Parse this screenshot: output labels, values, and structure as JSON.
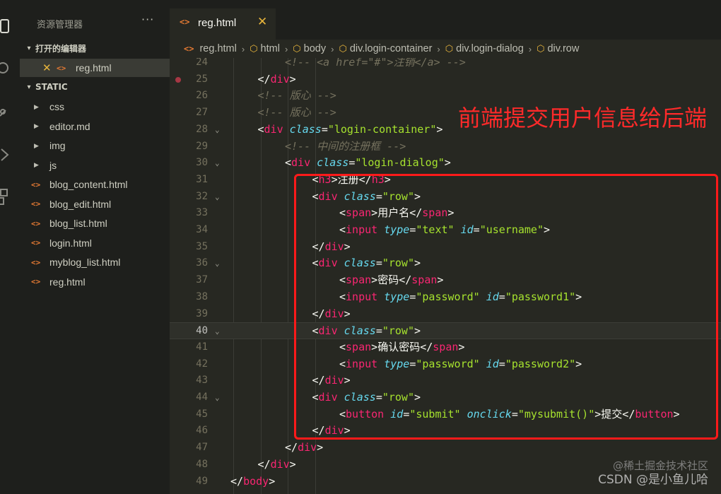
{
  "explorer": {
    "title": "资源管理器",
    "more_label": "···",
    "open_editors_label": "打开的编辑器",
    "open_editor_file": "reg.html",
    "folder_label": "STATIC",
    "folders": [
      "css",
      "editor.md",
      "img",
      "js"
    ],
    "files": [
      "blog_content.html",
      "blog_edit.html",
      "blog_list.html",
      "login.html",
      "myblog_list.html",
      "reg.html"
    ]
  },
  "tab": {
    "label": "reg.html",
    "close": "✕"
  },
  "breadcrumb": {
    "file": "reg.html",
    "items": [
      "html",
      "body",
      "div.login-container",
      "div.login-dialog",
      "div.row"
    ]
  },
  "editor": {
    "current_line": 40,
    "lines": [
      {
        "n": 24,
        "fold": false,
        "indent": 2,
        "tokens": [
          [
            "cm",
            "<!-- <a href=\"#\">注销</a> -->"
          ]
        ]
      },
      {
        "n": 25,
        "fold": false,
        "indent": 1,
        "tokens": [
          [
            "pu",
            "</"
          ],
          [
            "tg",
            "div"
          ],
          [
            "pu",
            ">"
          ]
        ]
      },
      {
        "n": 26,
        "fold": false,
        "indent": 1,
        "tokens": [
          [
            "cm",
            "<!-- 版心 -->"
          ]
        ]
      },
      {
        "n": 27,
        "fold": false,
        "indent": 1,
        "tokens": [
          [
            "cm",
            "<!-- 版心 -->"
          ]
        ]
      },
      {
        "n": 28,
        "fold": true,
        "indent": 1,
        "tokens": [
          [
            "pu",
            "<"
          ],
          [
            "tg",
            "div"
          ],
          [
            "tx",
            " "
          ],
          [
            "at",
            "class"
          ],
          [
            "pu",
            "="
          ],
          [
            "st",
            "\"login-container\""
          ],
          [
            "pu",
            ">"
          ]
        ]
      },
      {
        "n": 29,
        "fold": false,
        "indent": 2,
        "tokens": [
          [
            "cm",
            "<!-- 中间的注册框 -->"
          ]
        ]
      },
      {
        "n": 30,
        "fold": true,
        "indent": 2,
        "tokens": [
          [
            "pu",
            "<"
          ],
          [
            "tg",
            "div"
          ],
          [
            "tx",
            " "
          ],
          [
            "at",
            "class"
          ],
          [
            "pu",
            "="
          ],
          [
            "st",
            "\"login-dialog\""
          ],
          [
            "pu",
            ">"
          ]
        ]
      },
      {
        "n": 31,
        "fold": false,
        "indent": 3,
        "tokens": [
          [
            "pu",
            "<"
          ],
          [
            "tg",
            "h3"
          ],
          [
            "pu",
            ">"
          ],
          [
            "tx",
            "注册"
          ],
          [
            "pu",
            "</"
          ],
          [
            "tg",
            "h3"
          ],
          [
            "pu",
            ">"
          ]
        ]
      },
      {
        "n": 32,
        "fold": true,
        "indent": 3,
        "tokens": [
          [
            "pu",
            "<"
          ],
          [
            "tg",
            "div"
          ],
          [
            "tx",
            " "
          ],
          [
            "at",
            "class"
          ],
          [
            "pu",
            "="
          ],
          [
            "st",
            "\"row\""
          ],
          [
            "pu",
            ">"
          ]
        ]
      },
      {
        "n": 33,
        "fold": false,
        "indent": 4,
        "tokens": [
          [
            "pu",
            "<"
          ],
          [
            "tg",
            "span"
          ],
          [
            "pu",
            ">"
          ],
          [
            "tx",
            "用户名"
          ],
          [
            "pu",
            "</"
          ],
          [
            "tg",
            "span"
          ],
          [
            "pu",
            ">"
          ]
        ]
      },
      {
        "n": 34,
        "fold": false,
        "indent": 4,
        "tokens": [
          [
            "pu",
            "<"
          ],
          [
            "tg",
            "input"
          ],
          [
            "tx",
            " "
          ],
          [
            "at",
            "type"
          ],
          [
            "pu",
            "="
          ],
          [
            "st",
            "\"text\""
          ],
          [
            "tx",
            " "
          ],
          [
            "at",
            "id"
          ],
          [
            "pu",
            "="
          ],
          [
            "st",
            "\"username\""
          ],
          [
            "pu",
            ">"
          ]
        ]
      },
      {
        "n": 35,
        "fold": false,
        "indent": 3,
        "tokens": [
          [
            "pu",
            "</"
          ],
          [
            "tg",
            "div"
          ],
          [
            "pu",
            ">"
          ]
        ]
      },
      {
        "n": 36,
        "fold": true,
        "indent": 3,
        "tokens": [
          [
            "pu",
            "<"
          ],
          [
            "tg",
            "div"
          ],
          [
            "tx",
            " "
          ],
          [
            "at",
            "class"
          ],
          [
            "pu",
            "="
          ],
          [
            "st",
            "\"row\""
          ],
          [
            "pu",
            ">"
          ]
        ]
      },
      {
        "n": 37,
        "fold": false,
        "indent": 4,
        "tokens": [
          [
            "pu",
            "<"
          ],
          [
            "tg",
            "span"
          ],
          [
            "pu",
            ">"
          ],
          [
            "tx",
            "密码"
          ],
          [
            "pu",
            "</"
          ],
          [
            "tg",
            "span"
          ],
          [
            "pu",
            ">"
          ]
        ]
      },
      {
        "n": 38,
        "fold": false,
        "indent": 4,
        "tokens": [
          [
            "pu",
            "<"
          ],
          [
            "tg",
            "input"
          ],
          [
            "tx",
            " "
          ],
          [
            "at",
            "type"
          ],
          [
            "pu",
            "="
          ],
          [
            "st",
            "\"password\""
          ],
          [
            "tx",
            " "
          ],
          [
            "at",
            "id"
          ],
          [
            "pu",
            "="
          ],
          [
            "st",
            "\"password1\""
          ],
          [
            "pu",
            ">"
          ]
        ]
      },
      {
        "n": 39,
        "fold": false,
        "indent": 3,
        "tokens": [
          [
            "pu",
            "</"
          ],
          [
            "tg",
            "div"
          ],
          [
            "pu",
            ">"
          ]
        ]
      },
      {
        "n": 40,
        "fold": true,
        "indent": 3,
        "tokens": [
          [
            "pu",
            "<"
          ],
          [
            "tg",
            "div"
          ],
          [
            "tx",
            " "
          ],
          [
            "at",
            "class"
          ],
          [
            "pu",
            "="
          ],
          [
            "st",
            "\"row\""
          ],
          [
            "pu",
            ">"
          ]
        ]
      },
      {
        "n": 41,
        "fold": false,
        "indent": 4,
        "tokens": [
          [
            "pu",
            "<"
          ],
          [
            "tg",
            "span"
          ],
          [
            "pu",
            ">"
          ],
          [
            "tx",
            "确认密码"
          ],
          [
            "pu",
            "</"
          ],
          [
            "tg",
            "span"
          ],
          [
            "pu",
            ">"
          ]
        ]
      },
      {
        "n": 42,
        "fold": false,
        "indent": 4,
        "tokens": [
          [
            "pu",
            "<"
          ],
          [
            "tg",
            "input"
          ],
          [
            "tx",
            " "
          ],
          [
            "at",
            "type"
          ],
          [
            "pu",
            "="
          ],
          [
            "st",
            "\"password\""
          ],
          [
            "tx",
            " "
          ],
          [
            "at",
            "id"
          ],
          [
            "pu",
            "="
          ],
          [
            "st",
            "\"password2\""
          ],
          [
            "pu",
            ">"
          ]
        ]
      },
      {
        "n": 43,
        "fold": false,
        "indent": 3,
        "tokens": [
          [
            "pu",
            "</"
          ],
          [
            "tg",
            "div"
          ],
          [
            "pu",
            ">"
          ]
        ]
      },
      {
        "n": 44,
        "fold": true,
        "indent": 3,
        "tokens": [
          [
            "pu",
            "<"
          ],
          [
            "tg",
            "div"
          ],
          [
            "tx",
            " "
          ],
          [
            "at",
            "class"
          ],
          [
            "pu",
            "="
          ],
          [
            "st",
            "\"row\""
          ],
          [
            "pu",
            ">"
          ]
        ]
      },
      {
        "n": 45,
        "fold": false,
        "indent": 4,
        "tokens": [
          [
            "pu",
            "<"
          ],
          [
            "tg",
            "button"
          ],
          [
            "tx",
            " "
          ],
          [
            "at",
            "id"
          ],
          [
            "pu",
            "="
          ],
          [
            "st",
            "\"submit\""
          ],
          [
            "tx",
            " "
          ],
          [
            "at",
            "onclick"
          ],
          [
            "pu",
            "="
          ],
          [
            "st",
            "\"mysubmit()\""
          ],
          [
            "pu",
            ">"
          ],
          [
            "tx",
            "提交"
          ],
          [
            "pu",
            "</"
          ],
          [
            "tg",
            "button"
          ],
          [
            "pu",
            ">"
          ]
        ]
      },
      {
        "n": 46,
        "fold": false,
        "indent": 3,
        "tokens": [
          [
            "pu",
            "</"
          ],
          [
            "tg",
            "div"
          ],
          [
            "pu",
            ">"
          ]
        ]
      },
      {
        "n": 47,
        "fold": false,
        "indent": 2,
        "tokens": [
          [
            "pu",
            "</"
          ],
          [
            "tg",
            "div"
          ],
          [
            "pu",
            ">"
          ]
        ]
      },
      {
        "n": 48,
        "fold": false,
        "indent": 1,
        "tokens": [
          [
            "pu",
            "</"
          ],
          [
            "tg",
            "div"
          ],
          [
            "pu",
            ">"
          ]
        ]
      },
      {
        "n": 49,
        "fold": false,
        "indent": 0,
        "tokens": [
          [
            "pu",
            "</"
          ],
          [
            "tg",
            "body"
          ],
          [
            "pu",
            ">"
          ]
        ]
      }
    ]
  },
  "annotation": {
    "text": "前端提交用户信息给后端",
    "color": "#ff1a1a"
  },
  "watermark": {
    "line1": "@稀土掘金技术社区",
    "line2": "CSDN @是小鱼儿哈"
  },
  "colors": {
    "tag": "#f92672",
    "attr": "#66d9ef",
    "string": "#a6e22e",
    "comment": "#75715e",
    "text": "#f8f8f2",
    "file_icon": "#e37933"
  }
}
